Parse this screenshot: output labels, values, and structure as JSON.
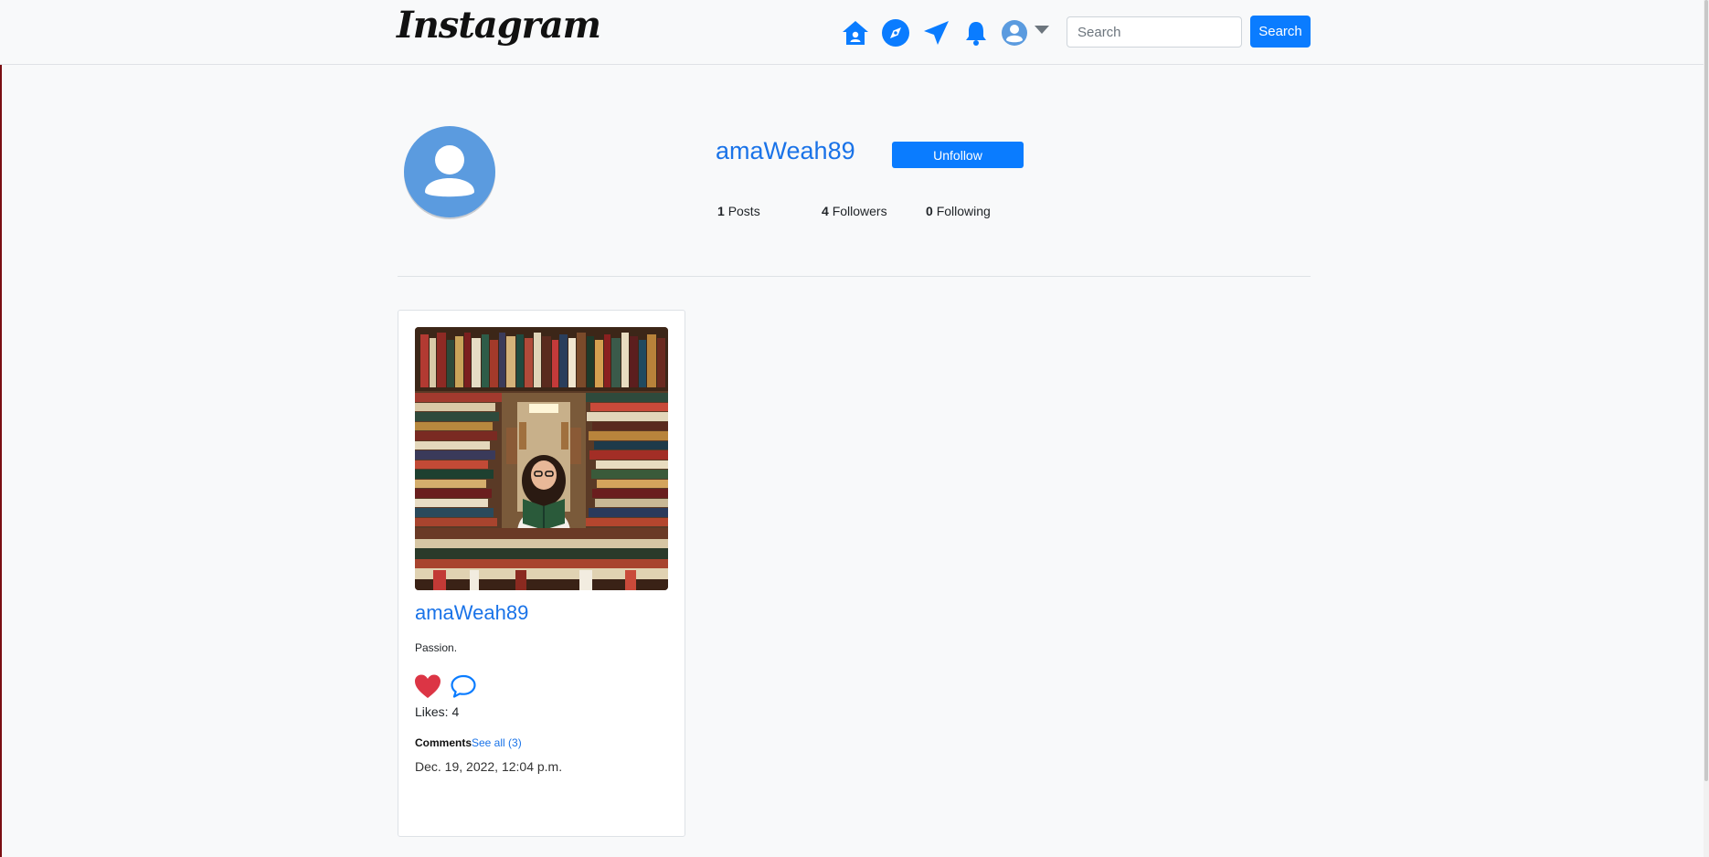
{
  "navbar": {
    "logo": "Instagram",
    "icons": [
      "home-icon",
      "explore-compass-icon",
      "direct-send-icon",
      "notifications-bell-icon",
      "profile-avatar-icon",
      "dropdown-caret-icon"
    ],
    "search_placeholder": "Search",
    "search_value": "",
    "search_button": "Search"
  },
  "profile": {
    "username": "amaWeah89",
    "unfollow_label": "Unfollow",
    "stats": {
      "posts_count": "1",
      "posts_label": "Posts",
      "followers_count": "4",
      "followers_label": "Followers",
      "following_count": "0",
      "following_label": "Following"
    }
  },
  "post": {
    "username": "amaWeah89",
    "caption": "Passion.",
    "likes_text": "Likes: 4",
    "comments_label": "Comments",
    "see_all": "See all (3)",
    "timestamp": "Dec. 19, 2022, 12:04 p.m."
  },
  "colors": {
    "accent": "#0a7cff",
    "link": "#1a73e8",
    "heart": "#dc3545",
    "avatar": "#5b9bdf"
  }
}
